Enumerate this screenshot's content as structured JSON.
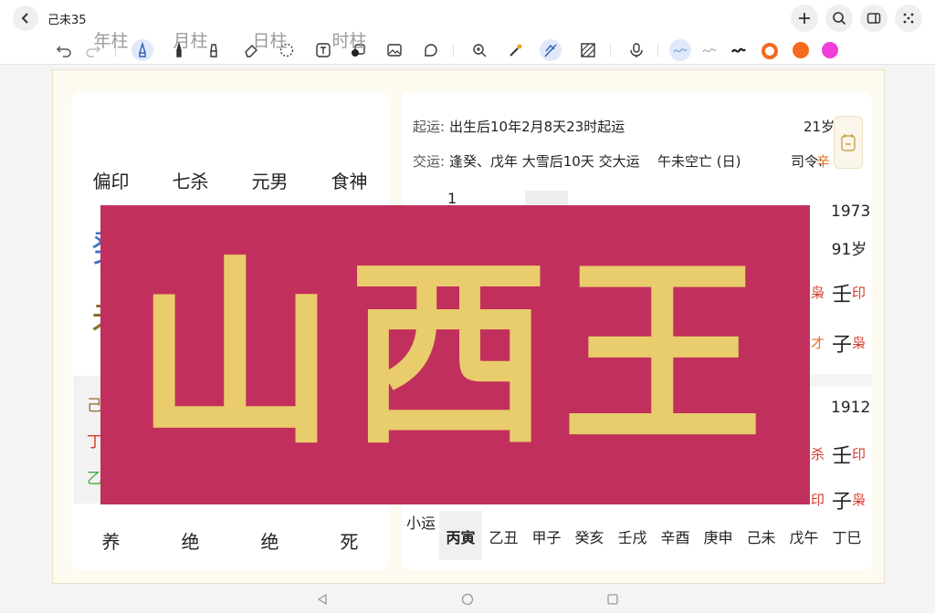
{
  "app": {
    "doc_title": "己未35"
  },
  "pillars": {
    "headers": [
      "年柱",
      "月柱",
      "日柱",
      "时柱"
    ],
    "gods": [
      "偏印",
      "七杀",
      "元男",
      "食神"
    ],
    "partial_chars": {
      "blue": "癸",
      "brown": "未"
    },
    "hidden_stems": [
      "己",
      "丁",
      "乙"
    ],
    "stages": [
      "养",
      "绝",
      "绝",
      "死"
    ]
  },
  "luck": {
    "qiyun_label": "起运:",
    "qiyun_text": "出生后10年2月8天23时起运",
    "age": "21岁",
    "jiaoyun_label": "交运:",
    "jiaoyun_text": "逢癸、戊年 大雪后10天 交大运",
    "kongwang": "午未空亡 (日)",
    "siling_label": "司令:",
    "siling_value": "辛",
    "upper_last": {
      "year": "1973",
      "age": "91岁",
      "stem": "壬",
      "stem_tag": "印",
      "branch": "子",
      "branch_tag": "枭"
    },
    "upper_partial_tags": [
      "枭",
      "才"
    ],
    "lower_last": {
      "year": "1912",
      "stem": "壬",
      "stem_tag": "印",
      "branch": "子",
      "branch_tag": "枭"
    },
    "lower_partial": {
      "year": "1",
      "tags": [
        "杀",
        "印"
      ]
    },
    "xiaoyun_label": "小运",
    "xiaoyun": [
      "丙寅",
      "乙丑",
      "甲子",
      "癸亥",
      "壬戌",
      "辛酉",
      "庚申",
      "己未",
      "戊午",
      "丁巳"
    ]
  },
  "banner": {
    "text": "山西王"
  },
  "colors": {
    "banner_bg": "#c1305c",
    "banner_text": "#e9cc6c",
    "accent_orange": "#f46a1f",
    "accent_pink": "#f03ed8"
  },
  "icons": {
    "top": [
      "chevron-left-icon",
      "plus-icon",
      "search-icon",
      "panel-icon",
      "more-icon"
    ],
    "toolbar": [
      "undo-icon",
      "redo-icon",
      "pen-icon",
      "marker-icon",
      "highlighter-icon",
      "eraser-icon",
      "lasso-icon",
      "text-box-icon",
      "shape-icon",
      "image-icon",
      "sticker-icon",
      "zoom-icon",
      "laser-pointer-icon",
      "hand-draw-icon",
      "pattern-icon",
      "microphone-icon"
    ]
  }
}
